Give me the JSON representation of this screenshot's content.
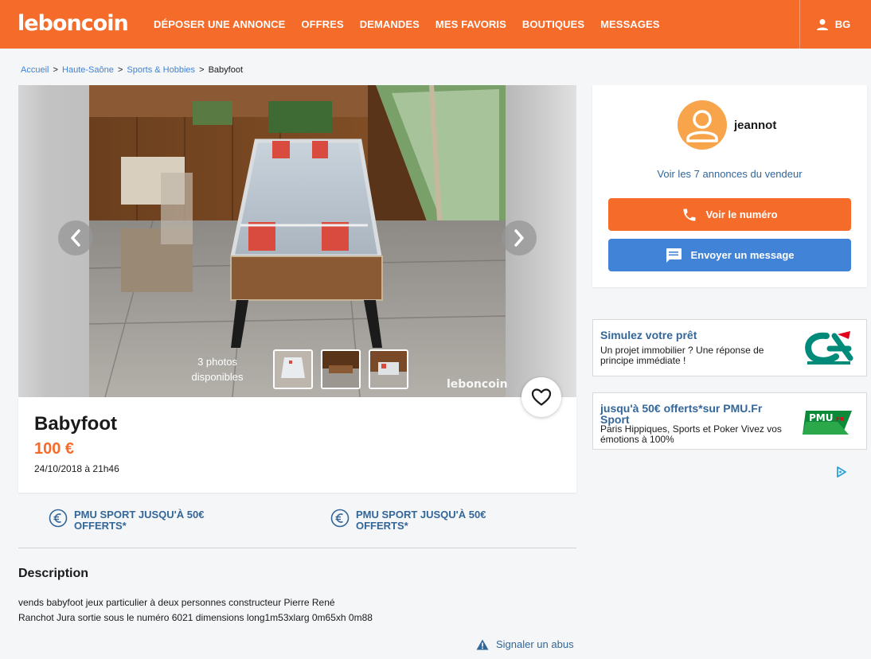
{
  "header": {
    "logo": "leboncoin",
    "nav": [
      "DÉPOSER UNE ANNONCE",
      "OFFRES",
      "DEMANDES",
      "MES FAVORIS",
      "BOUTIQUES",
      "MESSAGES"
    ],
    "user_initials": "BG"
  },
  "breadcrumb": {
    "items": [
      "Accueil",
      "Haute-Saône",
      "Sports & Hobbies"
    ],
    "current": "Babyfoot",
    "separator": ">"
  },
  "gallery": {
    "photo_count_line1": "3 photos",
    "photo_count_line2": "disponibles",
    "watermark": "leboncoin"
  },
  "listing": {
    "title": "Babyfoot",
    "price": "100 €",
    "date": "24/10/2018 à 21h46"
  },
  "promos": [
    {
      "label": "PMU SPORT JUSQU'À 50€ OFFERTS*"
    },
    {
      "label": "PMU SPORT JUSQU'À 50€ OFFERTS*"
    }
  ],
  "description": {
    "heading": "Description",
    "line1": "vends babyfoot jeux particulier à deux personnes constructeur Pierre René",
    "line2": "Ranchot Jura sortie sous le numéro 6021 dimensions long1m53xlarg 0m65xh 0m88"
  },
  "report_label": "Signaler un abus",
  "seller": {
    "name": "jeannot",
    "ads_link": "Voir les 7 annonces du vendeur",
    "phone_button": "Voir le numéro",
    "message_button": "Envoyer un message"
  },
  "ads": [
    {
      "title": "Simulez votre prêt",
      "body": "Un projet immobilier ? Une réponse de principe immédiate !",
      "logo": "CA"
    },
    {
      "title": "jusqu'à 50€ offerts*sur PMU.Fr Sport",
      "body": "Paris Hippiques, Sports et Poker Vivez vos émotions à 100%",
      "logo": "PMU.FR"
    }
  ],
  "colors": {
    "brand": "#f56b2a",
    "link": "#336699",
    "blue_button": "#4183d7"
  }
}
